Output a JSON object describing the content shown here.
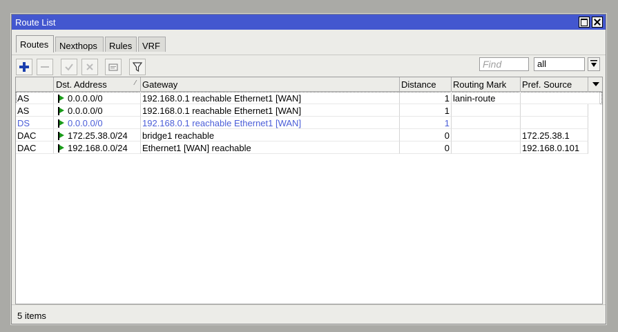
{
  "window": {
    "title": "Route List"
  },
  "tabs": [
    {
      "label": "Routes"
    },
    {
      "label": "Nexthops"
    },
    {
      "label": "Rules"
    },
    {
      "label": "VRF"
    }
  ],
  "toolbar": {
    "find_placeholder": "Find",
    "filter_value": "all"
  },
  "table": {
    "columns": [
      "",
      "Dst. Address",
      "Gateway",
      "Distance",
      "Routing Mark",
      "Pref. Source"
    ],
    "rows": [
      {
        "flags": "AS",
        "dst": "0.0.0.0/0",
        "gateway": "192.168.0.1 reachable Ethernet1 [WAN]",
        "distance": "1",
        "mark": "lanin-route",
        "pref": ""
      },
      {
        "flags": "AS",
        "dst": "0.0.0.0/0",
        "gateway": "192.168.0.1 reachable Ethernet1 [WAN]",
        "distance": "1",
        "mark": "",
        "pref": ""
      },
      {
        "flags": "DS",
        "dst": "0.0.0.0/0",
        "gateway": "192.168.0.1 reachable Ethernet1 [WAN]",
        "distance": "1",
        "mark": "",
        "pref": ""
      },
      {
        "flags": "DAC",
        "dst": "172.25.38.0/24",
        "gateway": "bridge1 reachable",
        "distance": "0",
        "mark": "",
        "pref": "172.25.38.1"
      },
      {
        "flags": "DAC",
        "dst": "192.168.0.0/24",
        "gateway": "Ethernet1 [WAN] reachable",
        "distance": "0",
        "mark": "",
        "pref": "192.168.0.101"
      }
    ]
  },
  "status": {
    "text": "5 items"
  },
  "colors": {
    "titlebar": "#4357cf",
    "disabled_row_text": "#4a5dd8",
    "flag_green": "#1a9a1a"
  }
}
